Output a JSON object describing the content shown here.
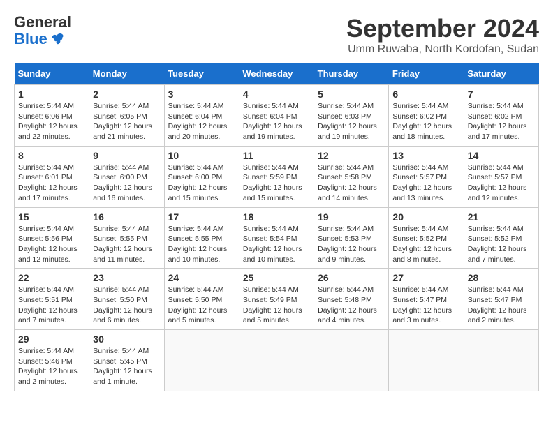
{
  "header": {
    "logo_general": "General",
    "logo_blue": "Blue",
    "month_title": "September 2024",
    "location": "Umm Ruwaba, North Kordofan, Sudan"
  },
  "days_of_week": [
    "Sunday",
    "Monday",
    "Tuesday",
    "Wednesday",
    "Thursday",
    "Friday",
    "Saturday"
  ],
  "weeks": [
    [
      {
        "day": "1",
        "sunrise": "5:44 AM",
        "sunset": "6:06 PM",
        "daylight": "12 hours and 22 minutes."
      },
      {
        "day": "2",
        "sunrise": "5:44 AM",
        "sunset": "6:05 PM",
        "daylight": "12 hours and 21 minutes."
      },
      {
        "day": "3",
        "sunrise": "5:44 AM",
        "sunset": "6:04 PM",
        "daylight": "12 hours and 20 minutes."
      },
      {
        "day": "4",
        "sunrise": "5:44 AM",
        "sunset": "6:04 PM",
        "daylight": "12 hours and 19 minutes."
      },
      {
        "day": "5",
        "sunrise": "5:44 AM",
        "sunset": "6:03 PM",
        "daylight": "12 hours and 19 minutes."
      },
      {
        "day": "6",
        "sunrise": "5:44 AM",
        "sunset": "6:02 PM",
        "daylight": "12 hours and 18 minutes."
      },
      {
        "day": "7",
        "sunrise": "5:44 AM",
        "sunset": "6:02 PM",
        "daylight": "12 hours and 17 minutes."
      }
    ],
    [
      {
        "day": "8",
        "sunrise": "5:44 AM",
        "sunset": "6:01 PM",
        "daylight": "12 hours and 17 minutes."
      },
      {
        "day": "9",
        "sunrise": "5:44 AM",
        "sunset": "6:00 PM",
        "daylight": "12 hours and 16 minutes."
      },
      {
        "day": "10",
        "sunrise": "5:44 AM",
        "sunset": "6:00 PM",
        "daylight": "12 hours and 15 minutes."
      },
      {
        "day": "11",
        "sunrise": "5:44 AM",
        "sunset": "5:59 PM",
        "daylight": "12 hours and 15 minutes."
      },
      {
        "day": "12",
        "sunrise": "5:44 AM",
        "sunset": "5:58 PM",
        "daylight": "12 hours and 14 minutes."
      },
      {
        "day": "13",
        "sunrise": "5:44 AM",
        "sunset": "5:57 PM",
        "daylight": "12 hours and 13 minutes."
      },
      {
        "day": "14",
        "sunrise": "5:44 AM",
        "sunset": "5:57 PM",
        "daylight": "12 hours and 12 minutes."
      }
    ],
    [
      {
        "day": "15",
        "sunrise": "5:44 AM",
        "sunset": "5:56 PM",
        "daylight": "12 hours and 12 minutes."
      },
      {
        "day": "16",
        "sunrise": "5:44 AM",
        "sunset": "5:55 PM",
        "daylight": "12 hours and 11 minutes."
      },
      {
        "day": "17",
        "sunrise": "5:44 AM",
        "sunset": "5:55 PM",
        "daylight": "12 hours and 10 minutes."
      },
      {
        "day": "18",
        "sunrise": "5:44 AM",
        "sunset": "5:54 PM",
        "daylight": "12 hours and 10 minutes."
      },
      {
        "day": "19",
        "sunrise": "5:44 AM",
        "sunset": "5:53 PM",
        "daylight": "12 hours and 9 minutes."
      },
      {
        "day": "20",
        "sunrise": "5:44 AM",
        "sunset": "5:52 PM",
        "daylight": "12 hours and 8 minutes."
      },
      {
        "day": "21",
        "sunrise": "5:44 AM",
        "sunset": "5:52 PM",
        "daylight": "12 hours and 7 minutes."
      }
    ],
    [
      {
        "day": "22",
        "sunrise": "5:44 AM",
        "sunset": "5:51 PM",
        "daylight": "12 hours and 7 minutes."
      },
      {
        "day": "23",
        "sunrise": "5:44 AM",
        "sunset": "5:50 PM",
        "daylight": "12 hours and 6 minutes."
      },
      {
        "day": "24",
        "sunrise": "5:44 AM",
        "sunset": "5:50 PM",
        "daylight": "12 hours and 5 minutes."
      },
      {
        "day": "25",
        "sunrise": "5:44 AM",
        "sunset": "5:49 PM",
        "daylight": "12 hours and 5 minutes."
      },
      {
        "day": "26",
        "sunrise": "5:44 AM",
        "sunset": "5:48 PM",
        "daylight": "12 hours and 4 minutes."
      },
      {
        "day": "27",
        "sunrise": "5:44 AM",
        "sunset": "5:47 PM",
        "daylight": "12 hours and 3 minutes."
      },
      {
        "day": "28",
        "sunrise": "5:44 AM",
        "sunset": "5:47 PM",
        "daylight": "12 hours and 2 minutes."
      }
    ],
    [
      {
        "day": "29",
        "sunrise": "5:44 AM",
        "sunset": "5:46 PM",
        "daylight": "12 hours and 2 minutes."
      },
      {
        "day": "30",
        "sunrise": "5:44 AM",
        "sunset": "5:45 PM",
        "daylight": "12 hours and 1 minute."
      },
      null,
      null,
      null,
      null,
      null
    ]
  ]
}
